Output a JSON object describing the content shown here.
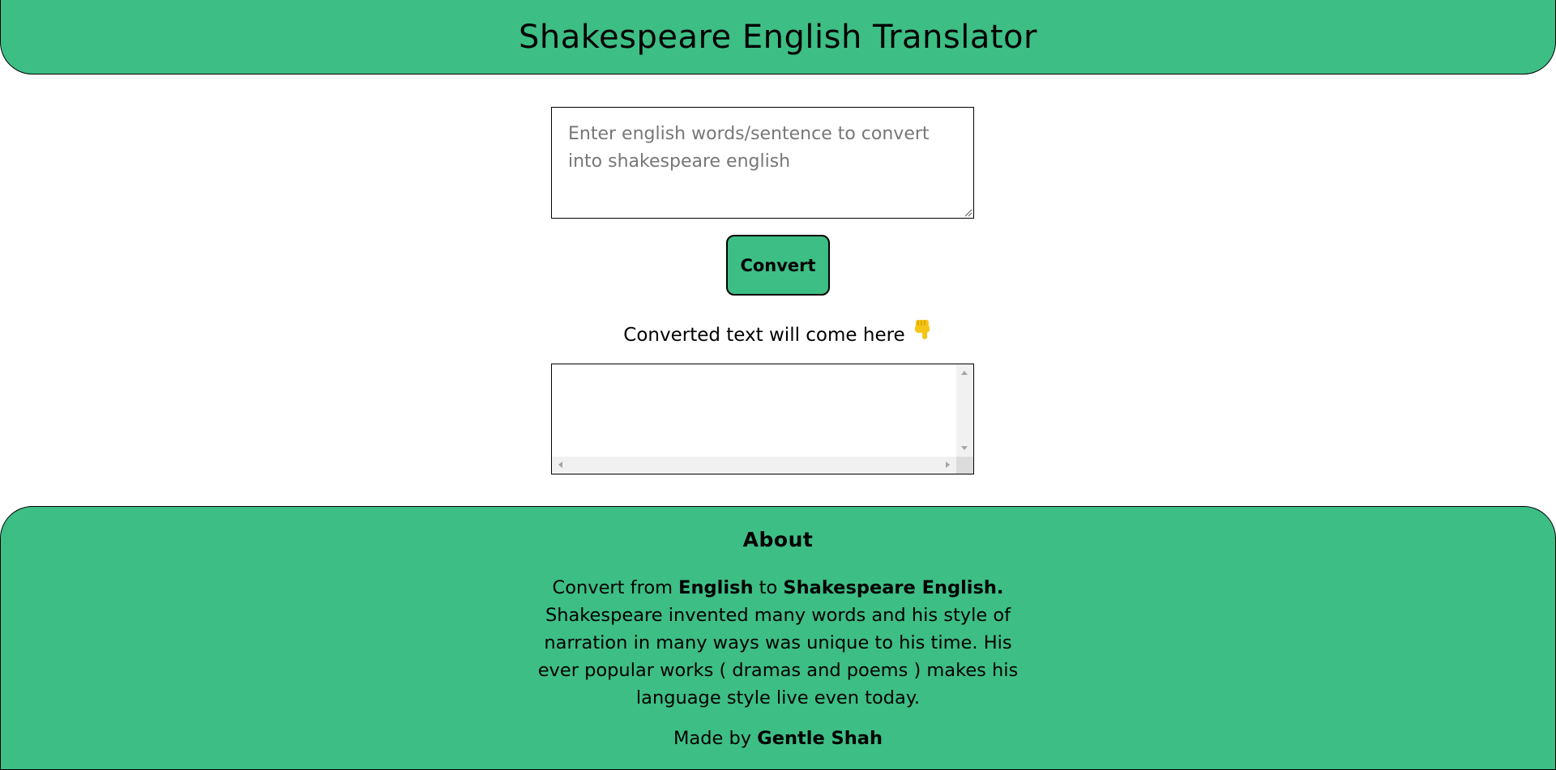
{
  "colors": {
    "accent": "#3dbe85",
    "border": "#000000",
    "placeholder": "#777777",
    "hand_emoji": "#f5c518"
  },
  "header": {
    "title": "Shakespeare English Translator"
  },
  "input": {
    "placeholder": "Enter english words/sentence to convert into shakespeare english",
    "value": ""
  },
  "convert_button": {
    "label": "Convert"
  },
  "output": {
    "label": "Converted text will come here",
    "label_icon": "pointing-down-hand-icon",
    "value": ""
  },
  "footer": {
    "heading": "About",
    "about": {
      "intro_prefix": "Convert from ",
      "from_lang": "English",
      "connector": " to ",
      "to_lang": "Shakespeare English.",
      "body": " Shakespeare invented many words and his style of narration in many ways was unique to his time. His ever popular works ( dramas and poems ) makes his language style live even today."
    },
    "credit_prefix": "Made by ",
    "credit_name": "Gentle Shah"
  }
}
